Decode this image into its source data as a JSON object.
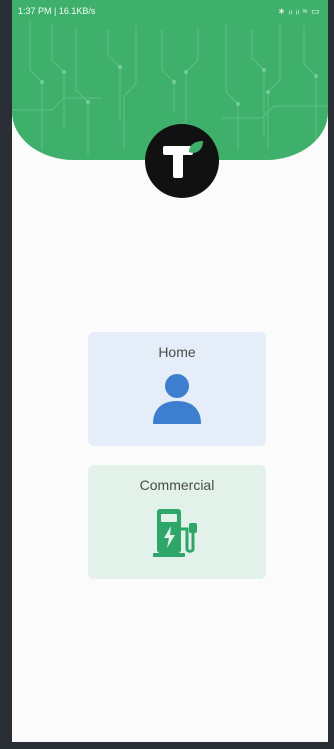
{
  "status_bar": {
    "left": "1:37 PM | 16.1KB/s",
    "right": "∗ ᵢₗ ᵢₗ ≈ ▭"
  },
  "brand": {
    "logo_icon": "t-leaf-logo-icon",
    "header_color": "#3fb06c"
  },
  "options": [
    {
      "label": "Home",
      "icon": "person-icon",
      "color": "#3d7fce"
    },
    {
      "label": "Commercial",
      "icon": "ev-charger-icon",
      "color": "#2ea66a"
    }
  ]
}
